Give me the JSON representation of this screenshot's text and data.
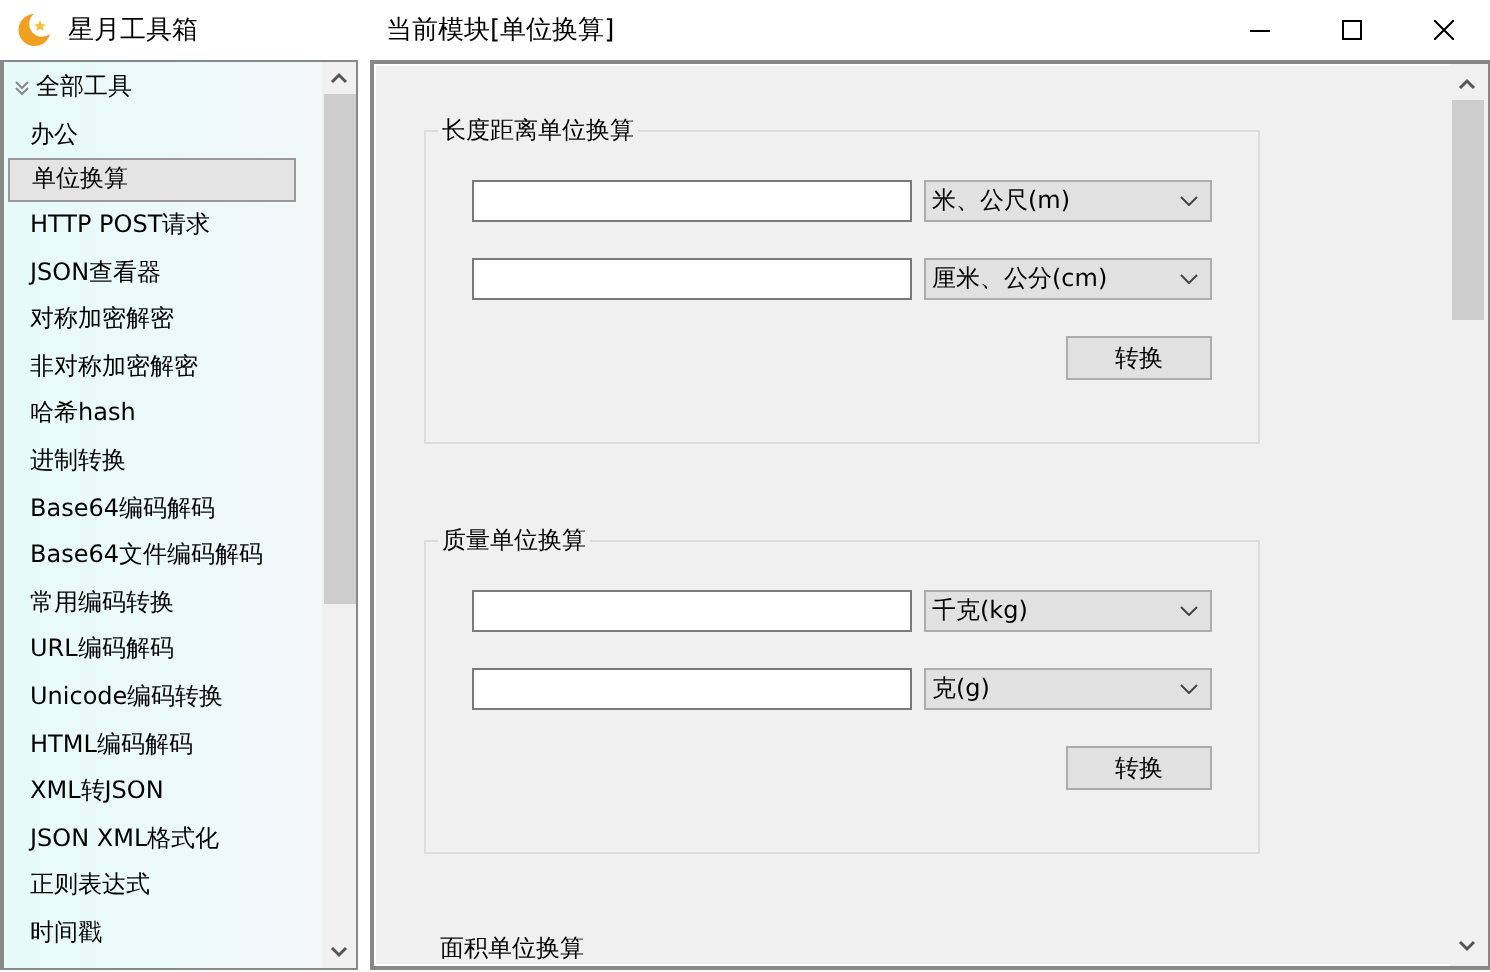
{
  "window": {
    "title": "星月工具箱",
    "module_title": "当前模块[单位换算]"
  },
  "sidebar": {
    "items": [
      {
        "label": "全部工具",
        "expanded": true,
        "selected": false,
        "children": [
          {
            "label": "办公",
            "selected": false
          },
          {
            "label": "单位换算",
            "selected": true
          },
          {
            "label": "HTTP POST请求",
            "selected": false
          },
          {
            "label": "JSON查看器",
            "selected": false
          },
          {
            "label": "对称加密解密",
            "selected": false
          },
          {
            "label": "非对称加密解密",
            "selected": false
          },
          {
            "label": "哈希hash",
            "selected": false
          },
          {
            "label": "进制转换",
            "selected": false
          },
          {
            "label": "Base64编码解码",
            "selected": false
          },
          {
            "label": "Base64文件编码解码",
            "selected": false
          },
          {
            "label": "常用编码转换",
            "selected": false
          },
          {
            "label": "URL编码解码",
            "selected": false
          },
          {
            "label": "Unicode编码转换",
            "selected": false
          },
          {
            "label": "HTML编码解码",
            "selected": false
          },
          {
            "label": "XML转JSON",
            "selected": false
          },
          {
            "label": "JSON XML格式化",
            "selected": false
          },
          {
            "label": "正则表达式",
            "selected": false
          },
          {
            "label": "时间戳",
            "selected": false
          }
        ]
      }
    ]
  },
  "groups": [
    {
      "title": "长度距离单位换算",
      "rows": [
        {
          "unit": "米、公尺(m)"
        },
        {
          "unit": "厘米、公分(cm)"
        }
      ],
      "button": "转换"
    },
    {
      "title": "质量单位换算",
      "rows": [
        {
          "unit": "千克(kg)"
        },
        {
          "unit": "克(g)"
        }
      ],
      "button": "转换"
    },
    {
      "title": "面积单位换算"
    }
  ]
}
